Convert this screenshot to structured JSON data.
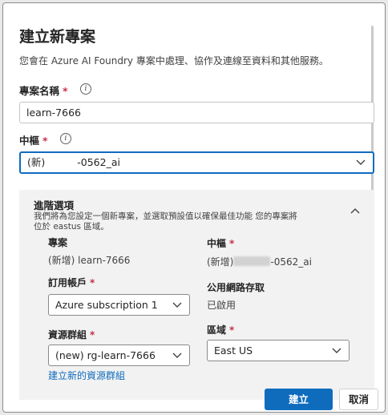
{
  "dialog": {
    "title": "建立新專案",
    "subtitle": "您會在 Azure AI Foundry 專案中處理、協作及連線至資料和其他服務。"
  },
  "project_name": {
    "label": "專案名稱",
    "required_mark": "*",
    "info_glyph": "i",
    "value": "learn-7666"
  },
  "hub": {
    "label": "中樞",
    "required_mark": "*",
    "info_glyph": "i",
    "value_prefix": "(新)",
    "value_suffix": "-0562_ai"
  },
  "advanced": {
    "title": "進階選項",
    "description": "我們將為您設定一個新專案，並選取預設值以確保最佳功能 您的專案將位於 eastus 區域。",
    "project_label": "專案",
    "project_value": "(新增) learn-7666",
    "hub_label": "中樞",
    "hub_required_mark": "*",
    "hub_value_prefix": "(新增)",
    "hub_value_suffix": "-0562_ai",
    "subscription_label": "訂用帳戶",
    "subscription_required_mark": "*",
    "subscription_value": "Azure subscription 1",
    "network_label": "公用網路存取",
    "network_value": "已啟用",
    "resource_group_label": "資源群組",
    "resource_group_required_mark": "*",
    "resource_group_value": "(new) rg-learn-7666",
    "region_label": "區域",
    "region_required_mark": "*",
    "region_value": "East US",
    "create_rg_link": "建立新的資源群組"
  },
  "footer": {
    "create_label": "建立",
    "cancel_label": "取消"
  },
  "icons": {
    "info": "info-icon",
    "chevron": "chevron-down-icon",
    "collapse": "chevron-up-icon"
  },
  "colors": {
    "accent": "#0f6cbd",
    "required": "#c4314b"
  }
}
